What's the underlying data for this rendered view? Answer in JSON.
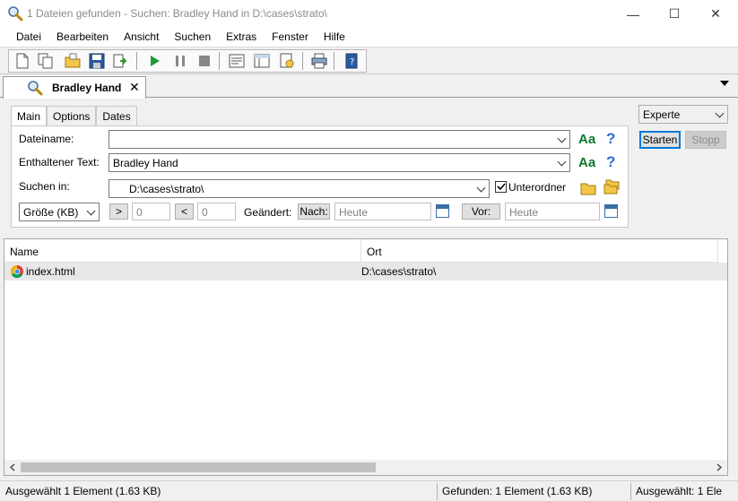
{
  "window": {
    "title": "1 Dateien gefunden - Suchen: Bradley Hand in D:\\cases\\strato\\",
    "controls": {
      "minimize": "—",
      "maximize": "☐",
      "close": "✕"
    }
  },
  "menu": [
    "Datei",
    "Bearbeiten",
    "Ansicht",
    "Suchen",
    "Extras",
    "Fenster",
    "Hilfe"
  ],
  "doc_tab": {
    "label": "Bradley Hand",
    "close": "✕"
  },
  "sub_tabs": [
    "Main",
    "Options",
    "Dates"
  ],
  "form": {
    "dateiname_label": "Dateiname:",
    "dateiname_value": "",
    "text_label": "Enthaltener Text:",
    "text_value": "Bradley Hand",
    "suchen_in_label": "Suchen in:",
    "suchen_in_value": "D:\\cases\\strato\\",
    "unterordner_label": "Unterordner",
    "unterordner_checked": true,
    "aa": "Aa",
    "help": "?",
    "size_select": "Größe (KB)",
    "gt": ">",
    "gt_value": "0",
    "lt": "<",
    "lt_value": "0",
    "geaendert_label": "Geändert:",
    "nach_label": "Nach:",
    "nach_placeholder": "Heute",
    "vor_label": "Vor:",
    "vor_placeholder": "Heute"
  },
  "right_panel": {
    "mode": "Experte",
    "start": "Starten",
    "stop": "Stopp"
  },
  "results": {
    "columns": [
      "Name",
      "Ort"
    ],
    "rows": [
      {
        "name": "index.html",
        "ort": "D:\\cases\\strato\\"
      }
    ]
  },
  "status": {
    "selected": "Ausgewählt 1 Element (1.63 KB)",
    "found": "Gefunden: 1 Element (1.63 KB)",
    "selected_right": "Ausgewählt: 1 Ele"
  },
  "colors": {
    "accent": "#0078d7",
    "aa": "#0a7a2a",
    "help": "#2a6fd6"
  }
}
